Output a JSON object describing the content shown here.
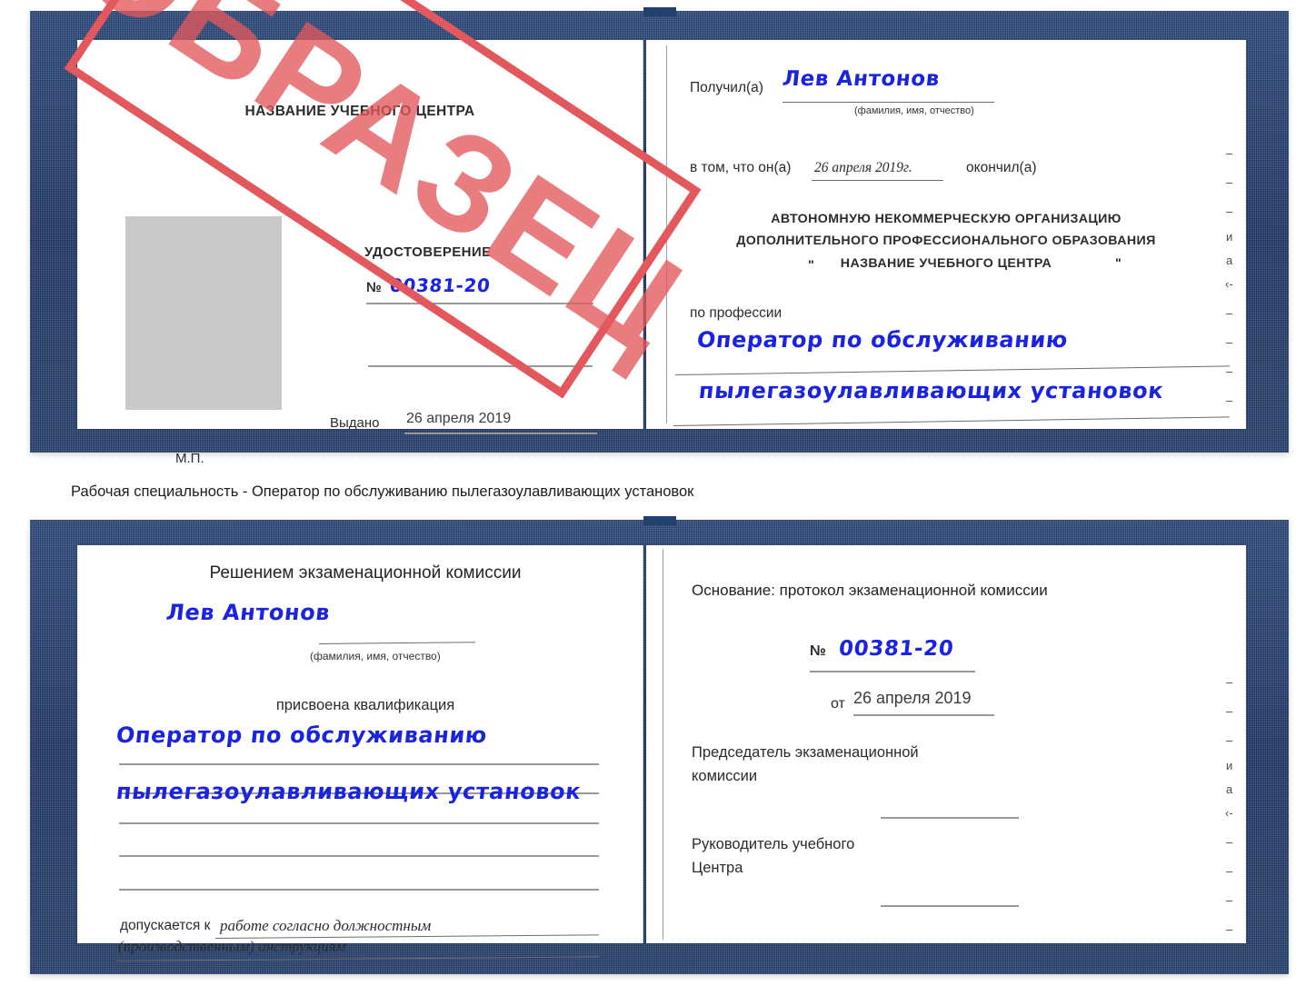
{
  "meta": {
    "watermark_text": "ОБРАЗЕЦ",
    "cover_color": "#23406f",
    "stamp_color": "#e2585c",
    "handwriting_color": "#1a23e0",
    "photo_placeholder_color": "#c9c9c9"
  },
  "caption": {
    "text": "Рабочая специальность - Оператор по обслуживанию пылегазоулавливающих установок"
  },
  "cert_top": {
    "left_page": {
      "center_title": "НАЗВАНИЕ УЧЕБНОГО ЦЕНТРА",
      "doc_kind": "УДОСТОВЕРЕНИЕ",
      "number_label": "№",
      "number_value": "00381-20",
      "issued_label": "Выдано",
      "issued_value": "26 апреля 2019",
      "seal_label": "М.П."
    },
    "right_page": {
      "received_label": "Получил(а)",
      "received_value": "Лев Антонов",
      "fio_hint": "(фамилия, имя, отчество)",
      "in_that_label": "в том, что он(а)",
      "completion_date": "26 апреля 2019г.",
      "finished_label": "окончил(а)",
      "org_line1": "АВТОНОМНУЮ НЕКОММЕРЧЕСКУЮ ОРГАНИЗАЦИЮ",
      "org_line2": "ДОПОЛНИТЕЛЬНОГО ПРОФЕССИОНАЛЬНОГО ОБРАЗОВАНИЯ",
      "org_quote_open": "\"",
      "org_line3": "НАЗВАНИЕ УЧЕБНОГО ЦЕНТРА",
      "org_quote_close": "\"",
      "profession_label": "по профессии",
      "profession_line1": "Оператор по обслуживанию",
      "profession_line2": "пылегазоулавливающих установок",
      "edge_glyphs": [
        "–",
        "–",
        "–",
        "и",
        "а",
        "‹-",
        "–",
        "–",
        "–",
        "–"
      ]
    }
  },
  "cert_bottom": {
    "left_page": {
      "title": "Решением экзаменационной комиссии",
      "name_value": "Лев Антонов",
      "fio_hint": "(фамилия, имя, отчество)",
      "qualification_label": "присвоена квалификация",
      "qualification_line1": "Оператор по обслуживанию",
      "qualification_line2": "пылегазоулавливающих установок",
      "admitted_label": "допускается к",
      "admitted_value_line1": "работе согласно должностным",
      "admitted_value_line2": "(производственным) инструкциям"
    },
    "right_page": {
      "basis_label": "Основание: протокол экзаменационной комиссии",
      "number_label": "№",
      "number_value": "00381-20",
      "date_label": "от",
      "date_value": "26 апреля 2019",
      "chairman_line1": "Председатель экзаменационной",
      "chairman_line2": "комиссии",
      "head_line1": "Руководитель учебного",
      "head_line2": "Центра",
      "edge_glyphs": [
        "–",
        "–",
        "–",
        "и",
        "а",
        "‹-",
        "–",
        "–",
        "–",
        "–"
      ]
    }
  }
}
